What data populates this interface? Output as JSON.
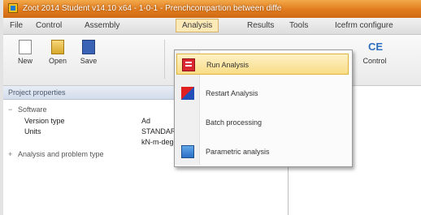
{
  "window": {
    "title": "Zoot 2014 Student v14.10 x64 - 1-0-1 - Prenchcompartion between diffe"
  },
  "menubar": {
    "items": [
      {
        "label": "File",
        "active": false
      },
      {
        "label": "Control",
        "active": false
      },
      {
        "label": "Assembly",
        "active": false
      },
      {
        "label": "Analysis",
        "active": true
      },
      {
        "label": "Results",
        "active": false
      },
      {
        "label": "Tools",
        "active": false
      },
      {
        "label": "Icefrm configure",
        "active": false
      }
    ]
  },
  "ribbon": {
    "buttons": [
      {
        "label": "New",
        "icon": "new-file-icon"
      },
      {
        "label": "Open",
        "icon": "open-folder-icon"
      },
      {
        "label": "Save",
        "icon": "save-disk-icon"
      },
      {
        "label": "Control",
        "icon": "control-icon"
      }
    ],
    "control_glyph": "CE"
  },
  "panel": {
    "header": "Project properties",
    "sections": [
      {
        "toggle": "−",
        "title": "Software"
      },
      {
        "toggle": "+",
        "title": "Analysis and problem type"
      }
    ],
    "rows": [
      {
        "key": "Version type",
        "value": "Ad"
      },
      {
        "key": "Units",
        "value": "STANDARD"
      },
      {
        "key": "",
        "value": "kN-m-deg-K-C"
      }
    ]
  },
  "dropdown": {
    "items": [
      {
        "label": "Run Analysis",
        "icon": "run-analysis-icon",
        "highlighted": true
      },
      {
        "label": "Restart Analysis",
        "icon": "restart-analysis-icon",
        "highlighted": false
      },
      {
        "label": "Batch processing",
        "icon": "",
        "highlighted": false
      },
      {
        "label": "Parametric analysis",
        "icon": "parametric-analysis-icon",
        "highlighted": false
      }
    ]
  }
}
